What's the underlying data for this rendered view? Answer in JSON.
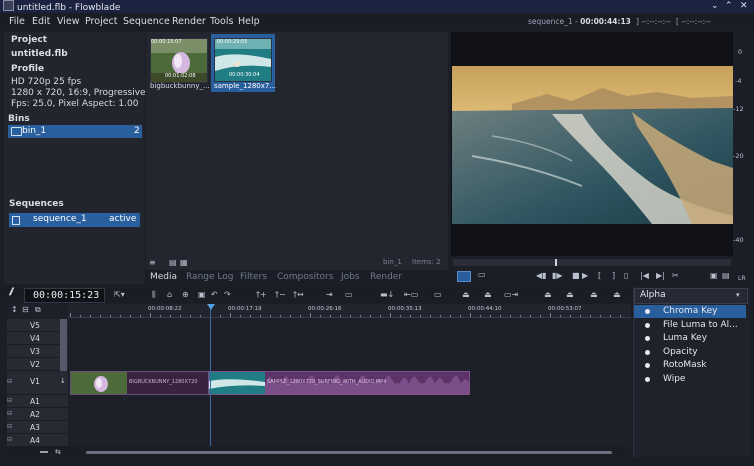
{
  "window": {
    "title": "untitled.flb - Flowblade"
  },
  "menu": [
    "File",
    "Edit",
    "View",
    "Project",
    "Sequence",
    "Render",
    "Tools",
    "Help"
  ],
  "top_status": {
    "sequence_name": "sequence_1",
    "timecode": "00:00:44:13",
    "in_mark": "--:--:--:--",
    "out_mark": "--:--:--:--"
  },
  "project": {
    "heading": "Project",
    "name": "untitled.flb",
    "profile_heading": "Profile",
    "profile_lines": [
      "HD 720p 25 fps",
      "1280 x 720, 16:9, Progressive",
      "Fps: 25.0, Pixel Aspect: 1.00"
    ],
    "bins_heading": "Bins",
    "bins": [
      {
        "name": "bin_1",
        "count": "2"
      }
    ],
    "sequences_heading": "Sequences",
    "sequences": [
      {
        "name": "sequence_1",
        "status": "active"
      }
    ]
  },
  "media": {
    "items": [
      {
        "name": "bigbuckbunny_...",
        "tc_top": "00:00:15:07",
        "tc_bottom": "00:01:02:08"
      },
      {
        "name": "sample_1280x7...",
        "tc_top": "00:00:29:05",
        "tc_bottom": "00:00:30:04"
      }
    ],
    "bin_label": "bin_1",
    "items_label": "Items: 2"
  },
  "tabs": [
    "Media",
    "Range Log",
    "Filters",
    "Compositors",
    "Jobs",
    "Render"
  ],
  "monitor": {
    "scale": [
      "0",
      "-4",
      "-12",
      "-20",
      "-40"
    ],
    "lr_label": "LR"
  },
  "timeline": {
    "timecode": "00:00:15:23",
    "ruler_labels": [
      "00:00:08:22",
      "00:00:17:19",
      "00:00:26:16",
      "00:00:35:13",
      "00:00:44:10",
      "00:00:53:07"
    ],
    "tracks": [
      "V5",
      "V4",
      "V3",
      "V2",
      "V1",
      "A1",
      "A2",
      "A3",
      "A4"
    ],
    "clips": [
      {
        "label": "BIGBUCKBUNNY_1280X720"
      },
      {
        "label": "SAMPLE_1280X720_SURFING_WITH_AUDIO.MP4"
      }
    ]
  },
  "effects": {
    "category": "Alpha",
    "items": [
      "Chroma Key",
      "File Luma to Al...",
      "Luma Key",
      "Opacity",
      "RotoMask",
      "Wipe"
    ],
    "selected_index": 0
  },
  "colors": {
    "accent": "#2a5f9e",
    "clip_video": "#4a2a52",
    "clip_audio": "#6a3a78",
    "playhead": "#4fa0e6"
  }
}
